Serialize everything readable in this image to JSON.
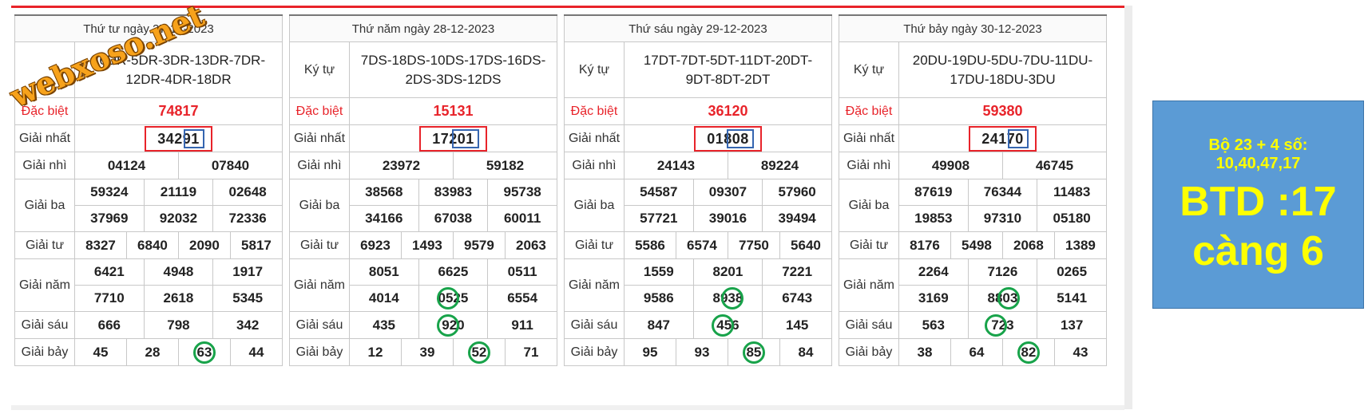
{
  "watermark": "webxoso.net",
  "boards": [
    {
      "date": "Thứ tư ngày 27-12-2023",
      "label_kytu": "",
      "kytu": "16DR-5DR-3DR-13DR-7DR-12DR-4DR-18DR",
      "dacbiet": "74817",
      "nhat": "34291",
      "nhi": [
        "04124",
        "07840"
      ],
      "ba": [
        "59324",
        "21119",
        "02648",
        "37969",
        "92032",
        "72336"
      ],
      "tu": [
        "8327",
        "6840",
        "2090",
        "5817"
      ],
      "nam": [
        "6421",
        "4948",
        "1917",
        "7710",
        "2618",
        "5345"
      ],
      "sau": [
        "666",
        "798",
        "342"
      ],
      "bay": [
        "45",
        "28",
        "63",
        "44"
      ]
    },
    {
      "date": "Thứ năm ngày 28-12-2023",
      "label_kytu": "Ký tự",
      "kytu": "7DS-18DS-10DS-17DS-16DS-2DS-3DS-12DS",
      "dacbiet": "15131",
      "nhat": "17201",
      "nhi": [
        "23972",
        "59182"
      ],
      "ba": [
        "38568",
        "83983",
        "95738",
        "34166",
        "67038",
        "60011"
      ],
      "tu": [
        "6923",
        "1493",
        "9579",
        "2063"
      ],
      "nam": [
        "8051",
        "6625",
        "0511",
        "4014",
        "0525",
        "6554"
      ],
      "sau": [
        "435",
        "920",
        "911"
      ],
      "bay": [
        "12",
        "39",
        "52",
        "71"
      ]
    },
    {
      "date": "Thứ sáu ngày 29-12-2023",
      "label_kytu": "Ký tự",
      "kytu": "17DT-7DT-5DT-11DT-20DT-9DT-8DT-2DT",
      "dacbiet": "36120",
      "nhat": "01808",
      "nhi": [
        "24143",
        "89224"
      ],
      "ba": [
        "54587",
        "09307",
        "57960",
        "57721",
        "39016",
        "39494"
      ],
      "tu": [
        "5586",
        "6574",
        "7750",
        "5640"
      ],
      "nam": [
        "1559",
        "8201",
        "7221",
        "9586",
        "8938",
        "6743"
      ],
      "sau": [
        "847",
        "456",
        "145"
      ],
      "bay": [
        "95",
        "93",
        "85",
        "84"
      ]
    },
    {
      "date": "Thứ bảy ngày 30-12-2023",
      "label_kytu": "Ký tự",
      "kytu": "20DU-19DU-5DU-7DU-11DU-17DU-18DU-3DU",
      "dacbiet": "59380",
      "nhat": "24170",
      "nhi": [
        "49908",
        "46745"
      ],
      "ba": [
        "87619",
        "76344",
        "11483",
        "19853",
        "97310",
        "05180"
      ],
      "tu": [
        "8176",
        "5498",
        "2068",
        "1389"
      ],
      "nam": [
        "2264",
        "7126",
        "0265",
        "3169",
        "8803",
        "5141"
      ],
      "sau": [
        "563",
        "723",
        "137"
      ],
      "bay": [
        "38",
        "64",
        "82",
        "43"
      ]
    }
  ],
  "labels": {
    "dacbiet": "Đặc biệt",
    "nhat": "Giải nhất",
    "nhi": "Giải nhì",
    "ba": "Giải ba",
    "tu": "Giải tư",
    "nam": "Giải năm",
    "sau": "Giải sáu",
    "bay": "Giải bảy"
  },
  "side_panel": {
    "line1": "Bộ 23 + 4 số:",
    "line2": "10,40,47,17",
    "big1": "BTD :17",
    "big2": "càng 6"
  },
  "colors": {
    "accent_red": "#e8232a",
    "circle_green": "#18a34a",
    "inner_box_blue": "#3565b0",
    "panel_blue": "#5b9bd5",
    "panel_text_yellow": "#ffff00"
  }
}
